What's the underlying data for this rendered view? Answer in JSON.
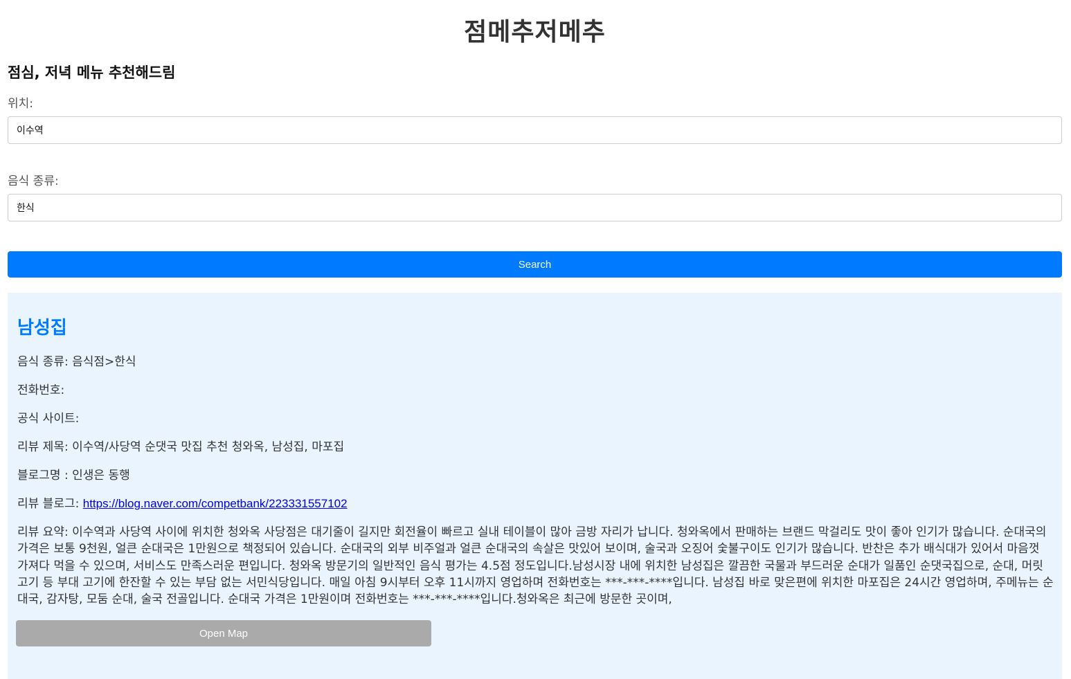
{
  "header": {
    "title": "점메추저메추",
    "subtitle": "점심, 저녁 메뉴 추천해드림"
  },
  "form": {
    "location_label": "위치:",
    "location_value": "이수역",
    "food_label": "음식 종류:",
    "food_value": "한식",
    "search_label": "Search"
  },
  "result": {
    "name": "남성집",
    "category_label": "음식 종류:",
    "category_value": "음식점>한식",
    "phone_label": "전화번호:",
    "phone_value": "",
    "site_label": "공식 사이트:",
    "site_value": "",
    "review_title_label": "리뷰 제목:",
    "review_title_value": "이수역/사당역 순댓국 맛집 추천 청와옥, 남성집, 마포집",
    "blog_name_label": "블로그명 :",
    "blog_name_value": "인생은 동행",
    "blog_link_label": "리뷰 블로그:",
    "blog_link_value": "https://blog.naver.com/competbank/223331557102",
    "summary_label": "리뷰 요약:",
    "summary_value": "이수역과 사당역 사이에 위치한 청와옥 사당점은 대기줄이 길지만 회전율이 빠르고 실내 테이블이 많아 금방 자리가 납니다. 청와옥에서 판매하는 브랜드 막걸리도 맛이 좋아 인기가 많습니다. 순대국의 가격은 보통 9천원, 얼큰 순대국은 1만원으로 책정되어 있습니다. 순대국의 외부 비주얼과 얼큰 순대국의 속살은 맛있어 보이며, 술국과 오징어 숯불구이도 인기가 많습니다. 반찬은 추가 배식대가 있어서 마음껏 가져다 먹을 수 있으며, 서비스도 만족스러운 편입니다. 청와옥 방문기의 일반적인 음식 평가는 4.5점 정도입니다.남성시장 내에 위치한 남성집은 깔끔한 국물과 부드러운 순대가 일품인 순댓국집으로, 순대, 머릿고기 등 부대 고기에 한잔할 수 있는 부담 없는 서민식당입니다. 매일 아침 9시부터 오후 11시까지 영업하며 전화번호는 ***-***-****입니다. 남성집 바로 맞은편에 위치한 마포집은 24시간 영업하며, 주메뉴는 순대국, 감자탕, 모둠 순대, 술국 전골입니다. 순대국 가격은 1만원이며 전화번호는 ***-***-****입니다.청와옥은 최근에 방문한 곳이며,",
    "open_map_label": "Open Map"
  },
  "colors": {
    "primary": "#007bff",
    "panel_bg": "#e9f4ff",
    "map_button": "#aaaaaa",
    "link": "#0000ee"
  }
}
